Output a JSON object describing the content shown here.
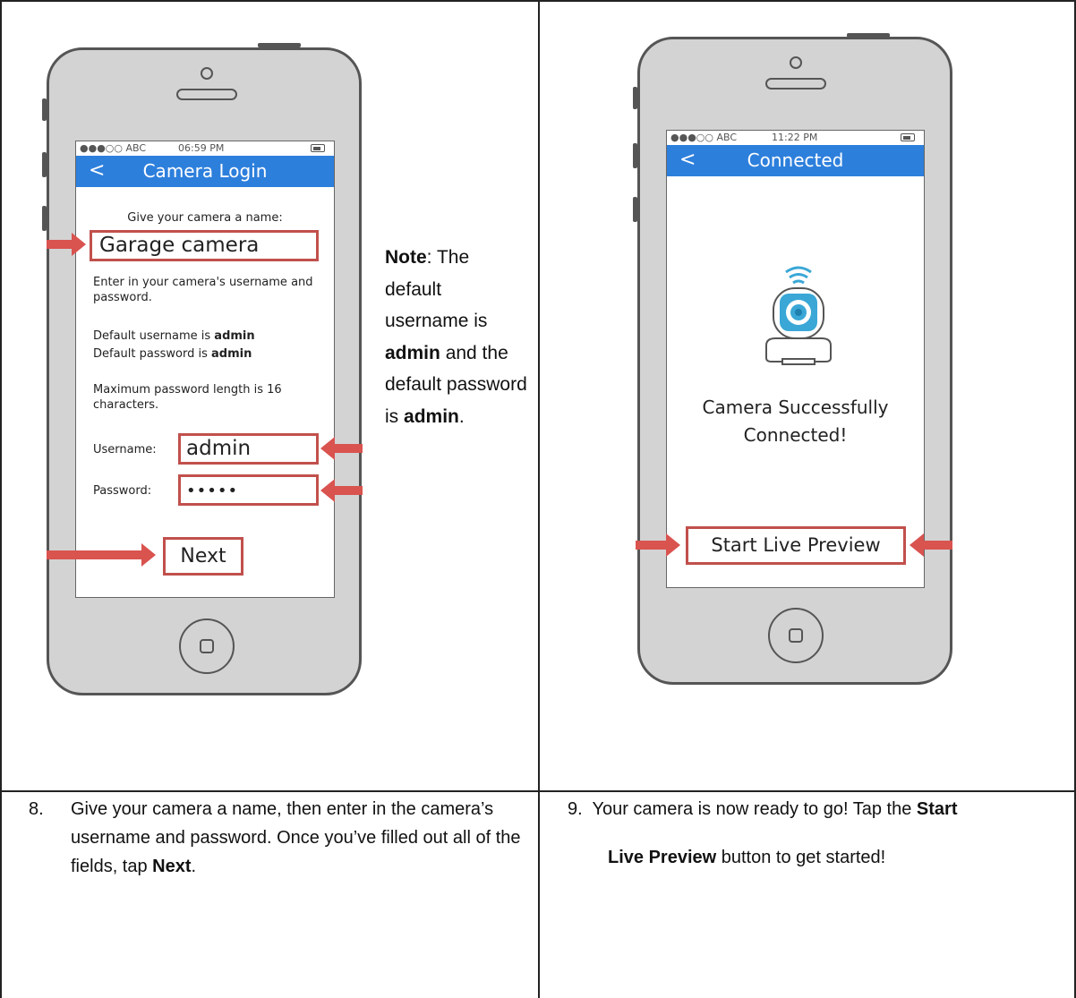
{
  "left_phone": {
    "status": {
      "carrier": "●●●○○ ABC",
      "time": "06:59 PM"
    },
    "nav_back": "<",
    "title": "Camera Login",
    "prompt": "Give your camera a name:",
    "name_value": "Garage camera",
    "instr1": "Enter in your camera's username and password.",
    "default_user_prefix": "Default username is",
    "default_user_value": "admin",
    "default_pass_prefix": "Default password is",
    "default_pass_value": "admin",
    "max_len": "Maximum password length is 16 characters.",
    "username_label": "Username:",
    "username_value": "admin",
    "password_label": "Password:",
    "password_value": "•••••",
    "next_label": "Next"
  },
  "note": {
    "bold_label": "Note",
    "text1": ": The default username is",
    "admin1": "admin",
    "text2": "and the default password is",
    "admin2": "admin",
    "end": "."
  },
  "right_phone": {
    "status": {
      "carrier": "●●●○○ ABC",
      "time": "11:22 PM"
    },
    "nav_back": "<",
    "title": "Connected",
    "success_line1": "Camera Successfully",
    "success_line2": "Connected!",
    "button_label": "Start Live Preview"
  },
  "caption_left": {
    "number": "8.",
    "text": "Give your camera a name, then enter in the camera’s username and password. Once you’ve filled out all of the fields, tap",
    "bold": "Next",
    "end": "."
  },
  "caption_right": {
    "number": "9.",
    "text1": "Your camera is now ready to go! Tap the",
    "bold1": "Start",
    "bold2": "Live Preview",
    "text2": "button to get started!"
  },
  "colors": {
    "accent_blue": "#2d7fdc",
    "highlight_red": "#c1504c",
    "arrow_red": "#d9534f",
    "camera_blue": "#3aa7d6"
  }
}
